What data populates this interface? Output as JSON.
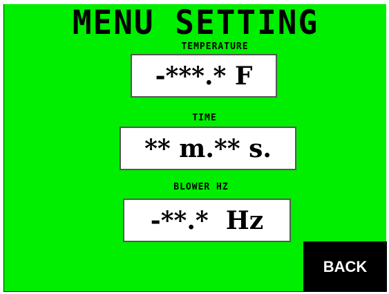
{
  "title": "MENU SETTING",
  "fields": {
    "temperature": {
      "label": "TEMPERATURE",
      "value": "-***.* F"
    },
    "time": {
      "label": "TIME",
      "value": "** m.** s."
    },
    "blower": {
      "label": "BLOWER HZ",
      "value": "-**.*  Hz"
    }
  },
  "back_label": "BACK",
  "colors": {
    "background": "#00ee00",
    "value_box": "#ffffff",
    "button": "#000000",
    "button_text": "#ffffff"
  }
}
